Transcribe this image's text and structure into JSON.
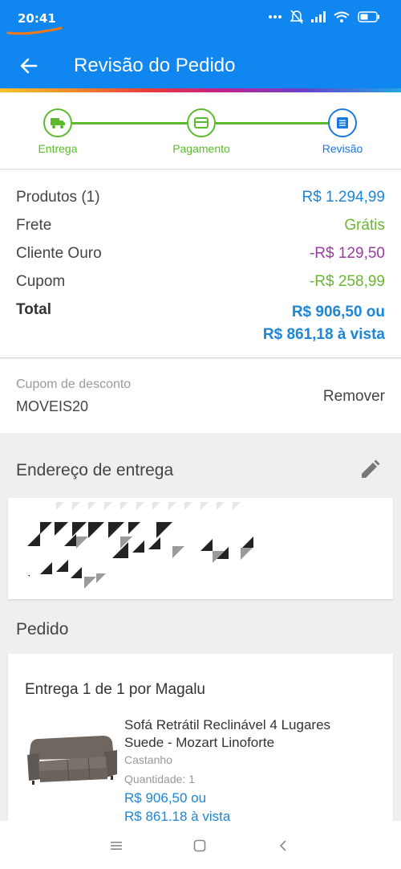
{
  "status_bar": {
    "time": "20:41",
    "icons": [
      "more-dots-icon",
      "bell-off-icon",
      "signal-icon",
      "wifi-icon",
      "battery-icon"
    ]
  },
  "header": {
    "title": "Revisão do Pedido"
  },
  "stepper": {
    "steps": [
      {
        "label": "Entrega",
        "icon": "truck-icon",
        "state": "done"
      },
      {
        "label": "Pagamento",
        "icon": "card-icon",
        "state": "done"
      },
      {
        "label": "Revisão",
        "icon": "list-icon",
        "state": "active"
      }
    ]
  },
  "summary": {
    "products_label": "Produtos (1)",
    "products_value": "R$ 1.294,99",
    "shipping_label": "Frete",
    "shipping_value": "Grátis",
    "gold_label": "Cliente Ouro",
    "gold_value": "-R$ 129,50",
    "coupon_label": "Cupom",
    "coupon_value": "-R$ 258,99",
    "total_label": "Total",
    "total_line1": "R$ 906,50 ou",
    "total_line2": "R$ 861,18 à vista"
  },
  "coupon": {
    "label": "Cupom de desconto",
    "code": "MOVEIS20",
    "remove_label": "Remover"
  },
  "address": {
    "title": "Endereço de entrega"
  },
  "order": {
    "title": "Pedido",
    "shipment": "Entrega 1 de 1 por Magalu",
    "product_name": "Sofá Retrátil Reclinável 4 Lugares Suede - Mozart Linoforte",
    "product_color": "Castanho",
    "quantity_label": "Quantidade:",
    "quantity_value": "1",
    "price_line1": "R$ 906,50 ou",
    "price_line2": "R$ 861,18 à vista"
  },
  "colors": {
    "header_blue": "#0f86f0",
    "step_green": "#5bbb2c",
    "step_active_blue": "#1a78e0",
    "price_blue": "#1d86d6",
    "discount_purple": "#9b3aa3"
  }
}
